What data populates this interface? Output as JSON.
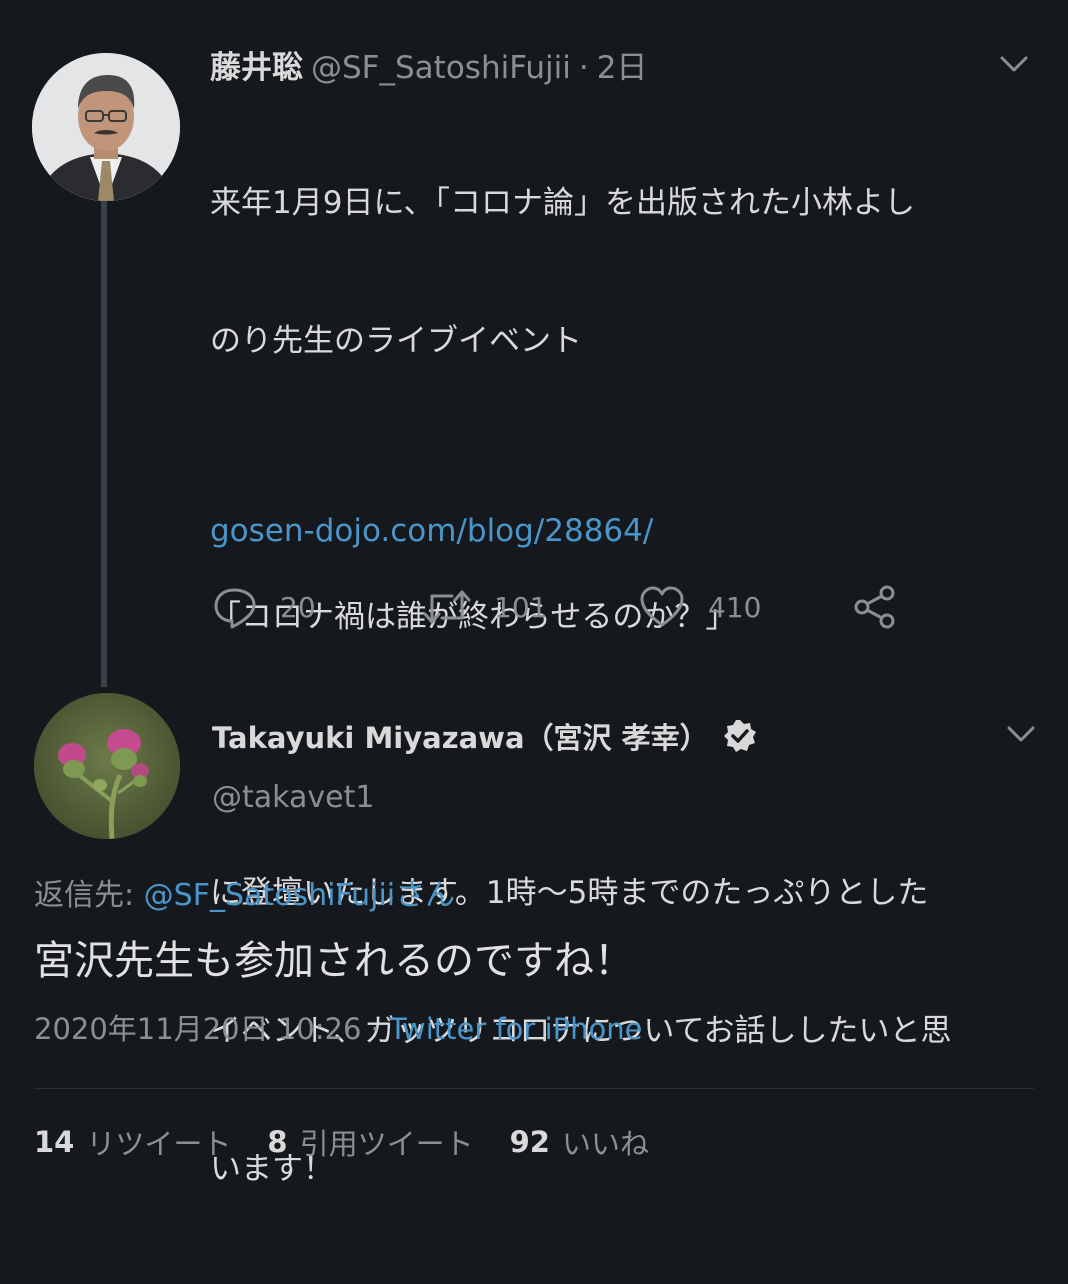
{
  "thread_parent": {
    "name": "藤井聡",
    "handle": "@SF_SatoshiFujii",
    "separator": "·",
    "time": "2日",
    "body_lines": [
      "来年1月9日に、「コロナ論」を出版された小林よし",
      "のり先生のライブイベント",
      "",
      "「コロナ禍は誰が終わらせるのか？」",
      "",
      "に登壇いたします。1時〜5時までのたっぷりとした",
      "イベント、ガッツリコロナについてお話ししたいと思",
      "います！"
    ],
    "link": "gosen-dojo.com/blog/28864/",
    "actions": {
      "reply_count": "20",
      "retweet_count": "101",
      "like_count": "410"
    },
    "icons": [
      "reply-icon",
      "retweet-icon",
      "like-icon",
      "share-icon",
      "chevron-down-icon"
    ]
  },
  "focused_tweet": {
    "name": "Takayuki Miyazawa（宮沢 孝幸）",
    "handle": "@takavet1",
    "reply_to_label": "返信先: ",
    "reply_to_mention": "@SF_SatoshiFujiiさん",
    "text": "宮沢先生も参加されるのですね！",
    "timestamp": "2020年11月20日 10:26",
    "timestamp_separator": " · ",
    "source": "Twitter for iPhone",
    "stats": {
      "retweets_num": "14",
      "retweets_label": "リツイート",
      "quotes_num": "8",
      "quotes_label": "引用ツイート",
      "likes_num": "92",
      "likes_label": "いいね"
    },
    "icons": [
      "verified-badge-icon",
      "chevron-down-icon"
    ]
  },
  "colors": {
    "background": "#15181d",
    "text_primary": "#d9d9d9",
    "text_secondary": "#8b8f93",
    "link": "#4a95c9",
    "thread_line": "#3b4148"
  }
}
